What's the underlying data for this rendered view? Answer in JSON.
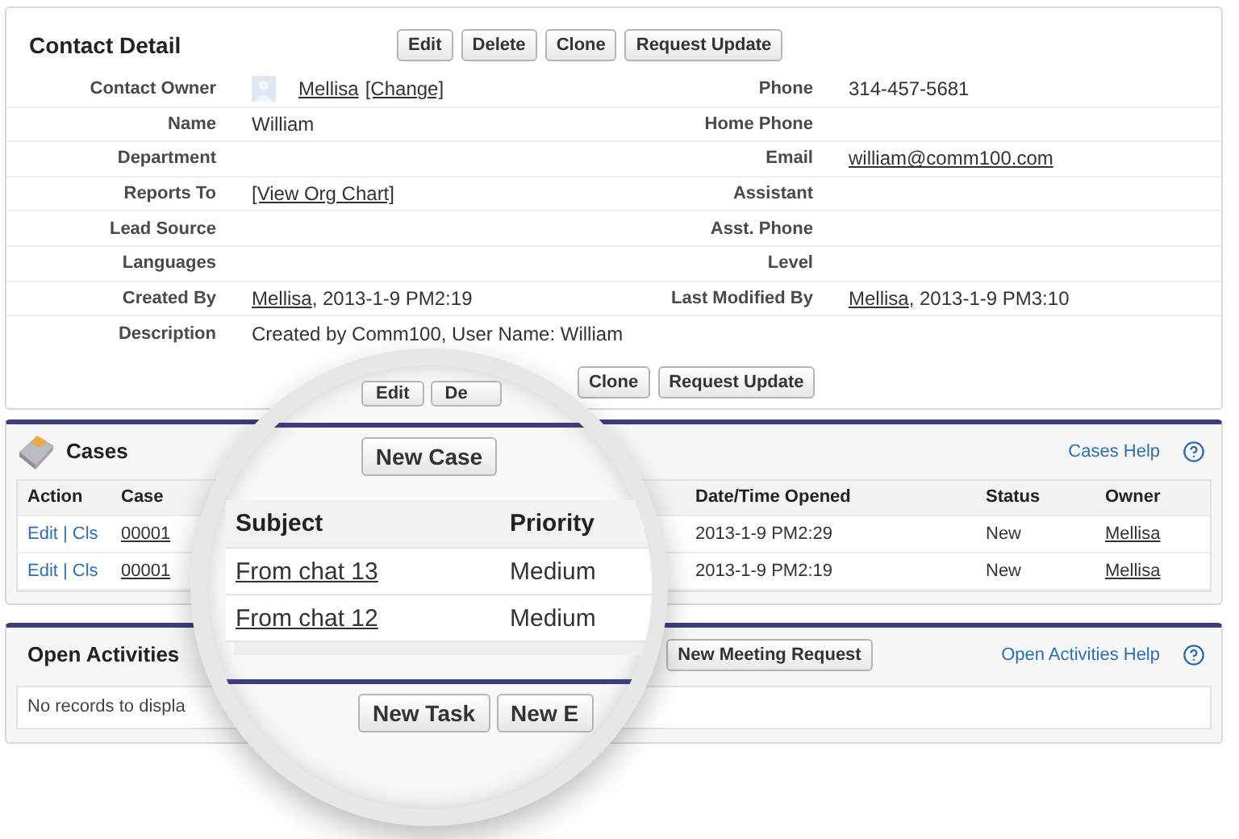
{
  "contact_detail": {
    "title": "Contact Detail",
    "buttons": [
      "Edit",
      "Delete",
      "Clone",
      "Request Update"
    ],
    "rows": [
      {
        "left": {
          "label": "Contact Owner",
          "avatar": true,
          "value": [
            {
              "text": "Mellisa",
              "link": true
            },
            {
              "text": "[Change]",
              "link": true
            }
          ]
        },
        "right": {
          "label": "Phone",
          "value": [
            {
              "text": "314-457-5681",
              "link": false
            }
          ]
        }
      },
      {
        "left": {
          "label": "Name",
          "value": [
            {
              "text": "William",
              "link": false
            }
          ]
        },
        "right": {
          "label": "Home Phone"
        }
      },
      {
        "left": {
          "label": "Department"
        },
        "right": {
          "label": "Email",
          "value": [
            {
              "text": "william@comm100.com",
              "link": true
            }
          ]
        }
      },
      {
        "left": {
          "label": "Reports To",
          "value": [
            {
              "text": "[View Org Chart]",
              "link": true
            }
          ]
        },
        "right": {
          "label": "Assistant"
        }
      },
      {
        "left": {
          "label": "Lead Source"
        },
        "right": {
          "label": "Asst. Phone"
        }
      },
      {
        "left": {
          "label": "Languages"
        },
        "right": {
          "label": "Level"
        }
      },
      {
        "left": {
          "label": "Created By",
          "value": [
            {
              "text": "Mellisa",
              "link": true
            },
            {
              "text": ", 2013-1-9 PM2:19",
              "link": false
            }
          ]
        },
        "right": {
          "label": "Last Modified By",
          "value": [
            {
              "text": "Mellisa",
              "link": true
            },
            {
              "text": ", 2013-1-9 PM3:10",
              "link": false
            }
          ]
        }
      },
      {
        "left": {
          "label": "Description",
          "value": [
            {
              "text": "Created by Comm100, User Name: William",
              "link": false
            }
          ]
        }
      }
    ],
    "bottom_buttons": [
      "Clone",
      "Request Update"
    ]
  },
  "cases": {
    "title": "Cases",
    "help": "Cases Help",
    "columns": [
      "Action",
      "Case",
      "Date/Time Opened",
      "Status",
      "Owner"
    ],
    "rows": [
      {
        "action": "Edit | Cls",
        "case": "00001",
        "opened": "2013-1-9 PM2:29",
        "status": "New",
        "owner": "Mellisa"
      },
      {
        "action": "Edit | Cls",
        "case": "00001",
        "opened": "2013-1-9 PM2:19",
        "status": "New",
        "owner": "Mellisa"
      }
    ]
  },
  "open_activities": {
    "title": "Open Activities",
    "button": "New Meeting Request",
    "help": "Open Activities Help",
    "empty": "No records to displa"
  },
  "magnifier": {
    "top_buttons": [
      "Edit",
      "De"
    ],
    "button": "New Case",
    "columns": [
      "Subject",
      "Priority"
    ],
    "rows": [
      {
        "subject": "From chat 13",
        "priority": "Medium"
      },
      {
        "subject": "From chat 12",
        "priority": "Medium"
      }
    ],
    "buttons": [
      "New Task",
      "New E"
    ]
  }
}
